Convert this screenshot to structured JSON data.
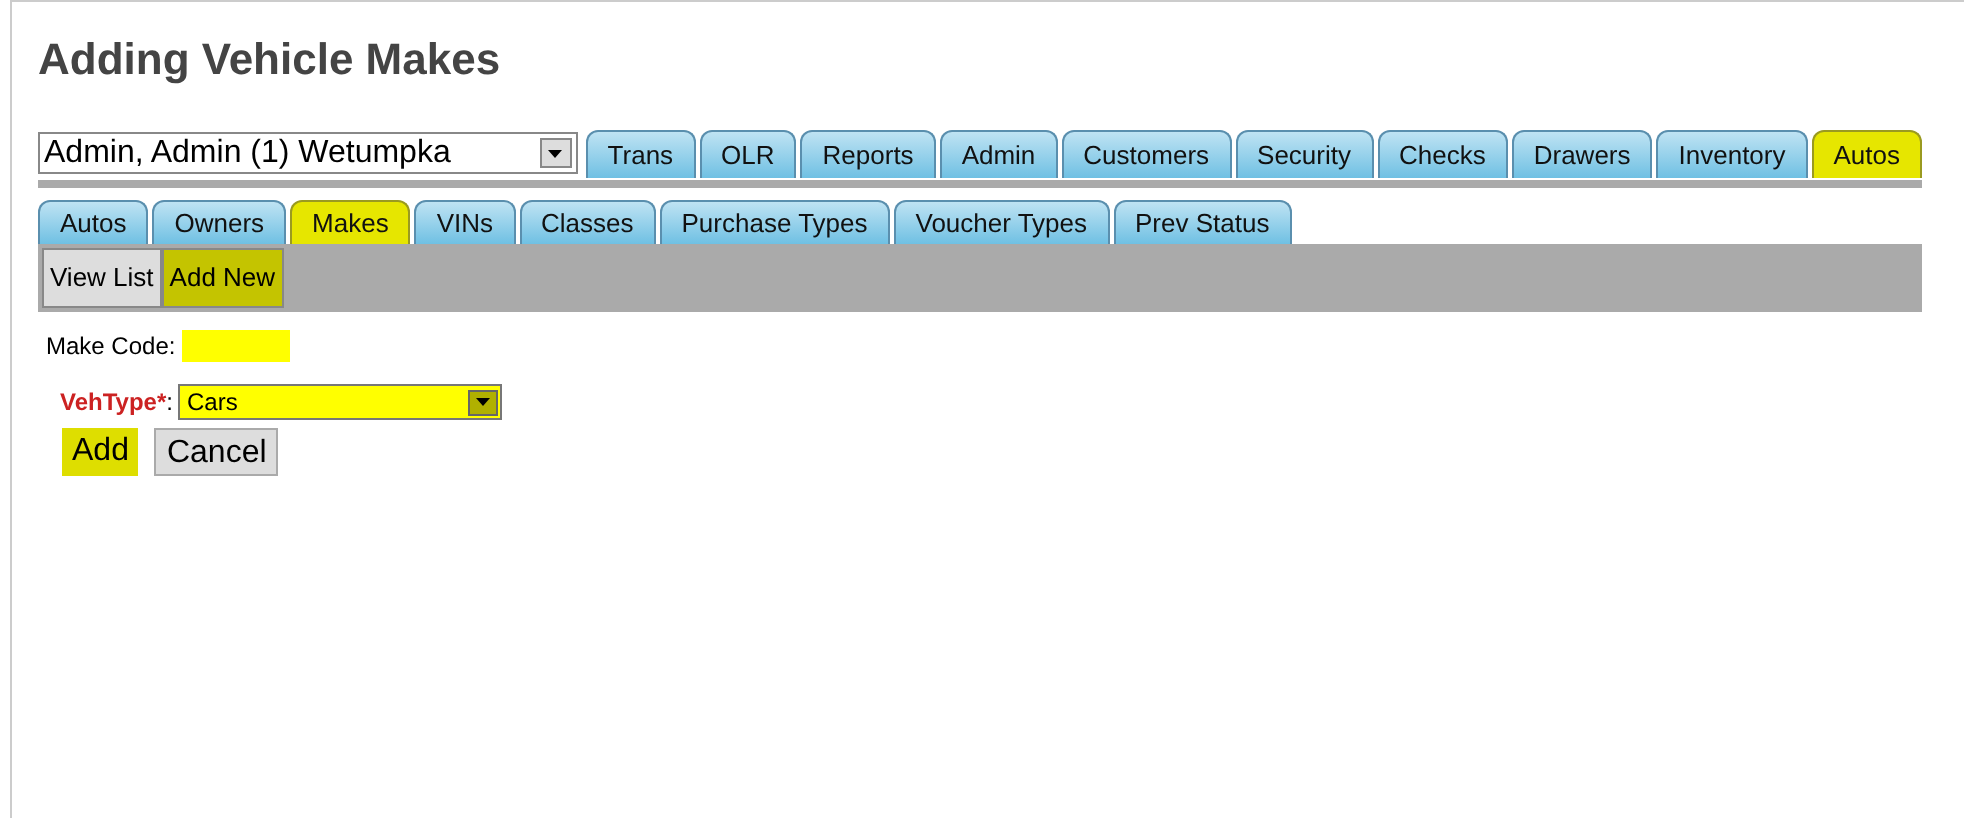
{
  "title": "Adding Vehicle Makes",
  "location_select": {
    "value": "Admin, Admin (1) Wetumpka"
  },
  "main_tabs": [
    {
      "label": "Trans",
      "selected": false
    },
    {
      "label": "OLR",
      "selected": false
    },
    {
      "label": "Reports",
      "selected": false
    },
    {
      "label": "Admin",
      "selected": false
    },
    {
      "label": "Customers",
      "selected": false
    },
    {
      "label": "Security",
      "selected": false
    },
    {
      "label": "Checks",
      "selected": false
    },
    {
      "label": "Drawers",
      "selected": false
    },
    {
      "label": "Inventory",
      "selected": false
    },
    {
      "label": "Autos",
      "selected": true
    }
  ],
  "sub_tabs": [
    {
      "label": "Autos",
      "selected": false
    },
    {
      "label": "Owners",
      "selected": false
    },
    {
      "label": "Makes",
      "selected": true
    },
    {
      "label": "VINs",
      "selected": false
    },
    {
      "label": "Classes",
      "selected": false
    },
    {
      "label": "Purchase Types",
      "selected": false
    },
    {
      "label": "Voucher Types",
      "selected": false
    },
    {
      "label": "Prev Status",
      "selected": false
    }
  ],
  "actions": [
    {
      "label": "View List",
      "selected": false
    },
    {
      "label": "Add New",
      "selected": true
    }
  ],
  "form": {
    "make_code_label": "Make Code:",
    "veh_type_label": "VehType",
    "required_mark": "*",
    "label_colon": ":",
    "veh_type_value": "Cars"
  },
  "buttons": [
    {
      "label": "Add",
      "selected": true
    },
    {
      "label": "Cancel",
      "selected": false
    }
  ]
}
